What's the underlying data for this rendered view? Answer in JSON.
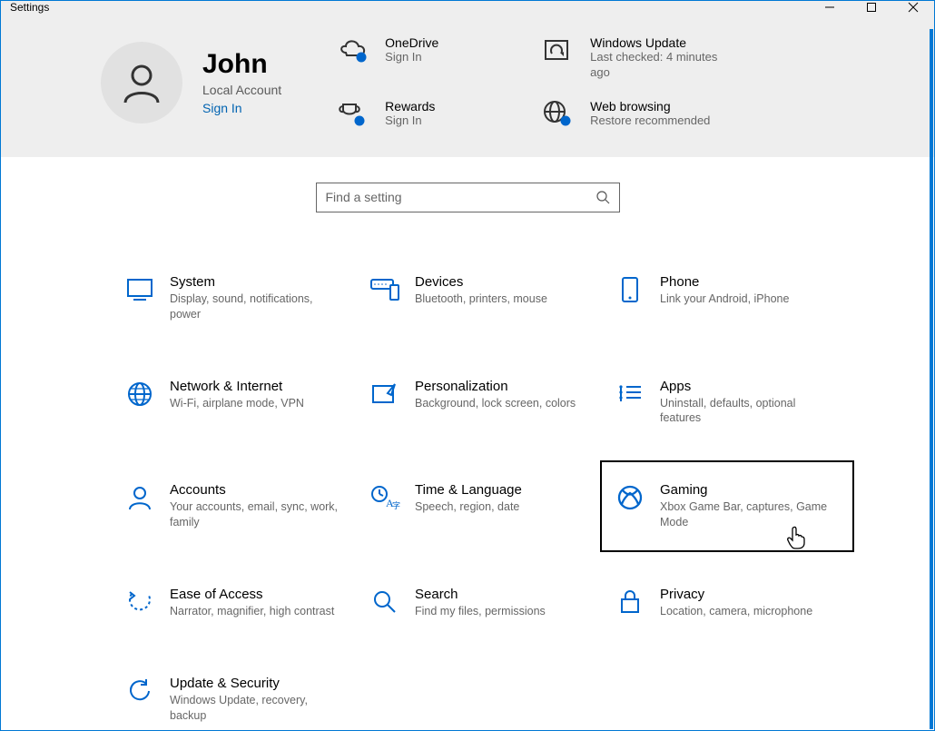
{
  "window": {
    "title": "Settings"
  },
  "profile": {
    "name": "John",
    "account_type": "Local Account",
    "signin": "Sign In"
  },
  "header_tiles": {
    "onedrive": {
      "title": "OneDrive",
      "sub": "Sign In"
    },
    "rewards": {
      "title": "Rewards",
      "sub": "Sign In"
    },
    "update": {
      "title": "Windows Update",
      "sub": "Last checked: 4 minutes ago"
    },
    "webbrowse": {
      "title": "Web browsing",
      "sub": "Restore recommended"
    }
  },
  "search": {
    "placeholder": "Find a setting"
  },
  "cats": {
    "system": {
      "title": "System",
      "sub": "Display, sound, notifications, power"
    },
    "devices": {
      "title": "Devices",
      "sub": "Bluetooth, printers, mouse"
    },
    "phone": {
      "title": "Phone",
      "sub": "Link your Android, iPhone"
    },
    "network": {
      "title": "Network & Internet",
      "sub": "Wi-Fi, airplane mode, VPN"
    },
    "personalization": {
      "title": "Personalization",
      "sub": "Background, lock screen, colors"
    },
    "apps": {
      "title": "Apps",
      "sub": "Uninstall, defaults, optional features"
    },
    "accounts": {
      "title": "Accounts",
      "sub": "Your accounts, email, sync, work, family"
    },
    "time": {
      "title": "Time & Language",
      "sub": "Speech, region, date"
    },
    "gaming": {
      "title": "Gaming",
      "sub": "Xbox Game Bar, captures, Game Mode"
    },
    "ease": {
      "title": "Ease of Access",
      "sub": "Narrator, magnifier, high contrast"
    },
    "search": {
      "title": "Search",
      "sub": "Find my files, permissions"
    },
    "privacy": {
      "title": "Privacy",
      "sub": "Location, camera, microphone"
    },
    "updatesec": {
      "title": "Update & Security",
      "sub": "Windows Update, recovery, backup"
    }
  },
  "colors": {
    "blue": "#0066cc",
    "accent": "#0078d4"
  }
}
